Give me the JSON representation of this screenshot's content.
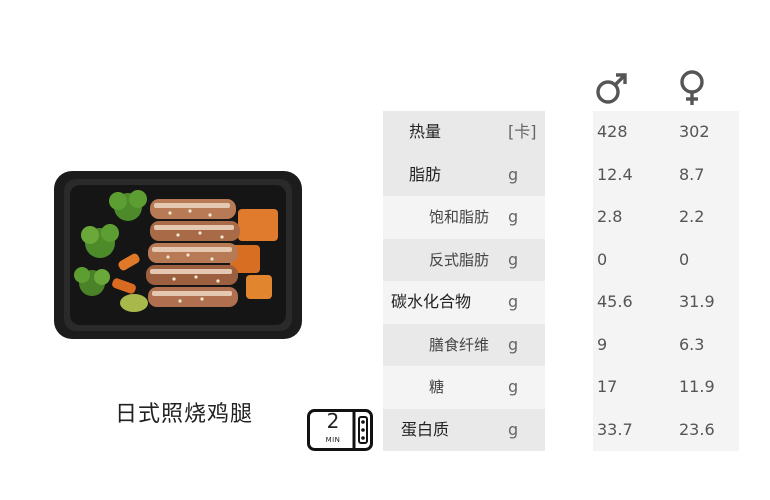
{
  "product": {
    "name": "日式照烧鸡腿",
    "microwave_minutes": "2",
    "microwave_unit": "MIN"
  },
  "columns": {
    "male_icon": "male-symbol-icon",
    "female_icon": "female-symbol-icon"
  },
  "nutrition": [
    {
      "name": "热量",
      "unit": "[卡]",
      "male": "428",
      "female": "302",
      "sub": false
    },
    {
      "name": "脂肪",
      "unit": "g",
      "male": "12.4",
      "female": "8.7",
      "sub": false
    },
    {
      "name": "饱和脂肪",
      "unit": "g",
      "male": "2.8",
      "female": "2.2",
      "sub": true
    },
    {
      "name": "反式脂肪",
      "unit": "g",
      "male": "0",
      "female": "0",
      "sub": true
    },
    {
      "name": "碳水化合物",
      "unit": "g",
      "male": "45.6",
      "female": "31.9",
      "sub": false
    },
    {
      "name": "膳食纤维",
      "unit": "g",
      "male": "9",
      "female": "6.3",
      "sub": true
    },
    {
      "name": "糖",
      "unit": "g",
      "male": "17",
      "female": "11.9",
      "sub": true
    },
    {
      "name": "蛋白质",
      "unit": "g",
      "male": "33.7",
      "female": "23.6",
      "sub": false
    }
  ],
  "colors": {
    "table_bg": "#f4f4f4",
    "label_bg": "#e9e9e9",
    "icon_color": "#555555"
  }
}
